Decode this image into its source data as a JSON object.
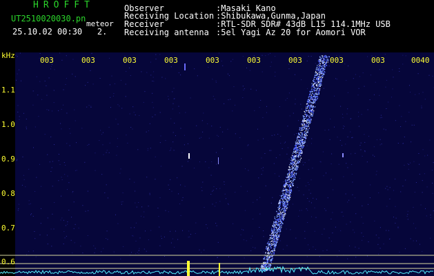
{
  "header": {
    "title": "HROFFT",
    "filename": "UT2510020030.pn",
    "tag": "meteor",
    "timestamp": "25.10.02 00:30",
    "channel": "2."
  },
  "info": [
    {
      "label": "Observer",
      "value": ":Masaki Kano"
    },
    {
      "label": "Receiving Location",
      "value": ":Shibukawa,Gunma,Japan"
    },
    {
      "label": "Receiver",
      "value": ":RTL-SDR SDR# 43dB L15 114.1MHz USB"
    },
    {
      "label": "Receiving antenna",
      "value": ":5el Yagi Az 20 for Aomori VOR"
    }
  ],
  "axis": {
    "y_unit": "kHz",
    "y_ticks": [
      "1.1",
      "1.0",
      "0.9",
      "0.8",
      "0.7",
      "0.6"
    ],
    "time_ticks": [
      "003",
      "003",
      "003",
      "003",
      "003",
      "003",
      "003",
      "003",
      "003",
      "0040"
    ]
  },
  "colors": {
    "background": "#000000",
    "spectrogram_bg": "#06063a",
    "signal": "#8ab0ff",
    "axis_text": "#ffff33",
    "title": "#2bd62b",
    "baseline": "#55f0ff"
  }
}
